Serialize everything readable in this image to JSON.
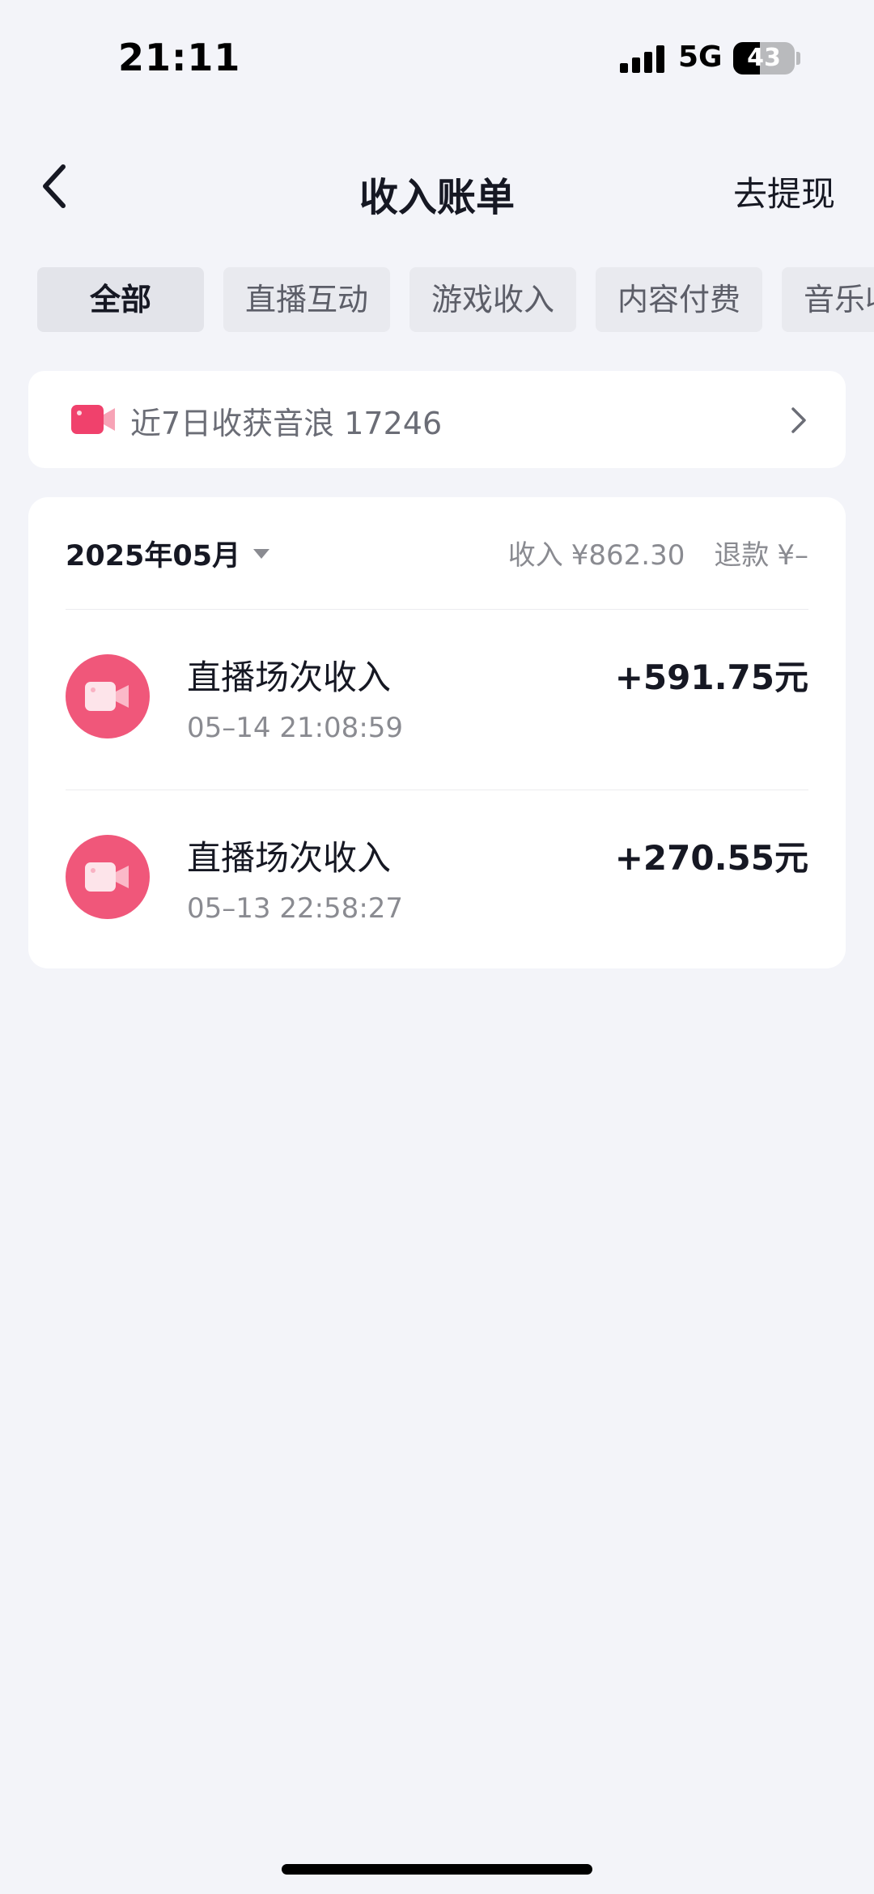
{
  "status_bar": {
    "time": "21:11",
    "network": "5G",
    "battery": "43",
    "battery_level": 0.43
  },
  "nav": {
    "title": "收入账单",
    "action": "去提现"
  },
  "tabs": [
    "全部",
    "直播互动",
    "游戏收入",
    "内容付费",
    "音乐收入"
  ],
  "promo": {
    "text": "近7日收获音浪 17246"
  },
  "bill": {
    "month": "2025年05月",
    "income_label": "收入",
    "income_value": "¥862.30",
    "refund_label": "退款",
    "refund_value": "¥–",
    "items": [
      {
        "title": "直播场次收入",
        "time": "05–14 21:08:59",
        "amount": "+591.75元"
      },
      {
        "title": "直播场次收入",
        "time": "05–13 22:58:27",
        "amount": "+270.55元"
      }
    ]
  },
  "colors": {
    "accent": "#f0577a",
    "background": "#f3f4f9"
  }
}
